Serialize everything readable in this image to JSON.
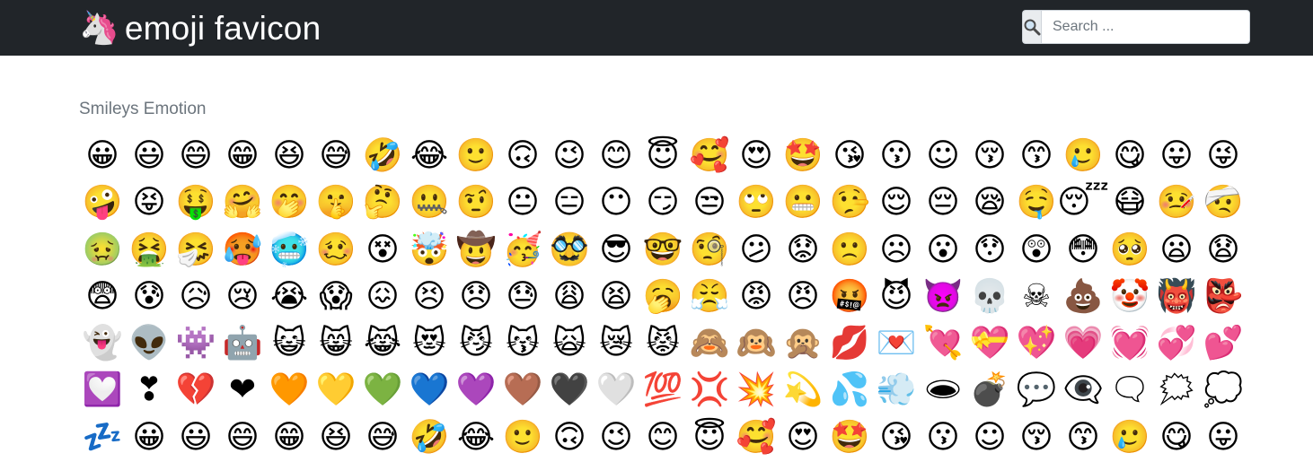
{
  "navbar": {
    "brand_icon": "🦄",
    "brand_text": "emoji favicon",
    "search_icon": "🔍",
    "search_placeholder": "Search ..."
  },
  "section": {
    "title": "Smileys Emotion"
  },
  "emojis": [
    "😀",
    "😃",
    "😄",
    "😁",
    "😆",
    "😅",
    "🤣",
    "😂",
    "🙂",
    "🙃",
    "😉",
    "😊",
    "😇",
    "🥰",
    "😍",
    "🤩",
    "😘",
    "😗",
    "☺",
    "😚",
    "😙",
    "🥲",
    "😋",
    "😛",
    "😜",
    "🤪",
    "😝",
    "🤑",
    "🤗",
    "🤭",
    "🤫",
    "🤔",
    "🤐",
    "🤨",
    "😐",
    "😑",
    "😶",
    "😏",
    "😒",
    "🙄",
    "😬",
    "🤥",
    "😌",
    "😔",
    "😪",
    "🤤",
    "😴",
    "😷",
    "🤒",
    "🤕",
    "🤢",
    "🤮",
    "🤧",
    "🥵",
    "🥶",
    "🥴",
    "😵",
    "🤯",
    "🤠",
    "🥳",
    "🥸",
    "😎",
    "🤓",
    "🧐",
    "😕",
    "😟",
    "🙁",
    "☹",
    "😮",
    "😯",
    "😲",
    "😳",
    "🥺",
    "😦",
    "😧",
    "😨",
    "😰",
    "😥",
    "😢",
    "😭",
    "😱",
    "😖",
    "😣",
    "😞",
    "😓",
    "😩",
    "😫",
    "🥱",
    "😤",
    "😡",
    "😠",
    "🤬",
    "😈",
    "👿",
    "💀",
    "☠",
    "💩",
    "🤡",
    "👹",
    "👺",
    "👻",
    "👽",
    "👾",
    "🤖",
    "😺",
    "😸",
    "😹",
    "😻",
    "😼",
    "😽",
    "🙀",
    "😿",
    "😾",
    "🙈",
    "🙉",
    "🙊",
    "💋",
    "💌",
    "💘",
    "💝",
    "💖",
    "💗",
    "💓",
    "💞",
    "💕",
    "💟",
    "❣",
    "💔",
    "❤",
    "🧡",
    "💛",
    "💚",
    "💙",
    "💜",
    "🤎",
    "🖤",
    "🤍",
    "💯",
    "💢",
    "💥",
    "💫",
    "💦",
    "💨",
    "🕳",
    "💣",
    "💬",
    "👁️‍🗨️",
    "🗨",
    "🗯",
    "💭",
    "💤",
    "😀",
    "😃",
    "😄",
    "😁",
    "😆",
    "😅",
    "🤣",
    "😂",
    "🙂",
    "🙃",
    "😉",
    "😊",
    "😇",
    "🥰",
    "😍",
    "🤩",
    "😘",
    "😗",
    "☺",
    "😚",
    "😙",
    "🥲",
    "😋",
    "😛"
  ]
}
